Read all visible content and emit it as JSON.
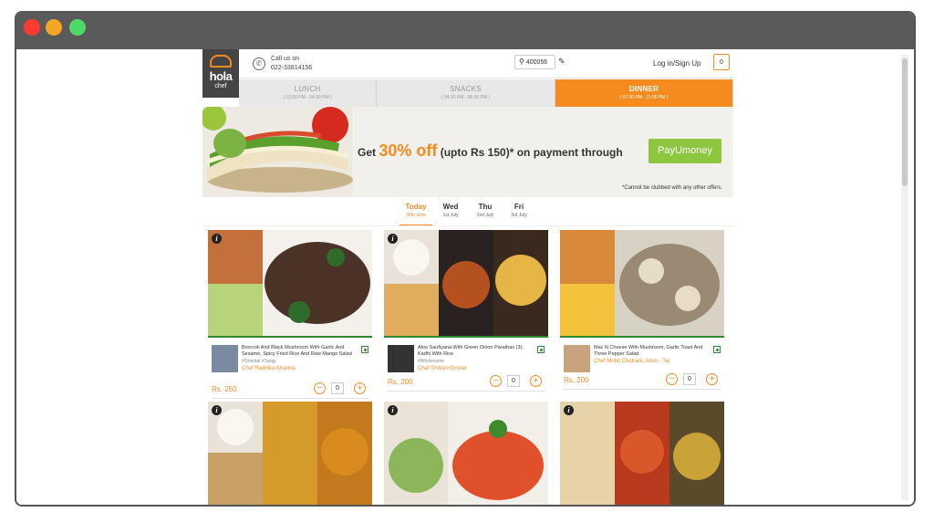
{
  "header": {
    "logo_brand": "hola",
    "logo_sub": "chef",
    "call_label": "Call us on",
    "phone": "022-33814156",
    "pincode": "400056",
    "login": "Log in/Sign Up",
    "cart_count": "0"
  },
  "meals": [
    {
      "name": "LUNCH",
      "time": "( 12:00 PM - 04:30 PM )",
      "active": false
    },
    {
      "name": "SNACKS",
      "time": "( 04:30 PM - 06:30 PM )",
      "active": false
    },
    {
      "name": "DINNER",
      "time": "( 07:30 PM - 11:30 PM )",
      "active": true
    }
  ],
  "banner": {
    "prefix": "Get ",
    "highlight": "30% off",
    "suffix": " (upto Rs 150)* on payment through",
    "payu": "PayUmoney",
    "note": "*Cannot be clubbed with any other offers."
  },
  "days": [
    {
      "name": "Today",
      "date": "30th June",
      "active": true
    },
    {
      "name": "Wed",
      "date": "1st July",
      "active": false
    },
    {
      "name": "Thu",
      "date": "2nd July",
      "active": false
    },
    {
      "name": "Fri",
      "date": "3rd July",
      "active": false
    }
  ],
  "cards": [
    {
      "dish": "Broccoli And Black Mushroom With Garlic And Sesame, Spicy Fried Rice And Raw Mango Salad",
      "tags": "#Oriental #Tangy",
      "chef": "Chef Radhika Khanna",
      "price": "Rs. 250",
      "qty": "0"
    },
    {
      "dish": "Aloo Saufiyana With Green Onion Parathas (3), Kadhi With Rice",
      "tags": "#Wholesome",
      "chef": "Chef Shivani Grover",
      "price": "Rs. 200",
      "qty": "0"
    },
    {
      "dish": "Mac N Cheese With Mushroom, Garlic Toast And Three Pepper Salad",
      "tags": "",
      "chef": "Chef Mohit Chotrani, Alum - Taj",
      "price": "Rs. 200",
      "qty": "0"
    }
  ],
  "icons": {
    "info": "i",
    "minus": "−",
    "plus": "+",
    "phone": "✆",
    "pin": "⚲",
    "edit": "✎"
  }
}
